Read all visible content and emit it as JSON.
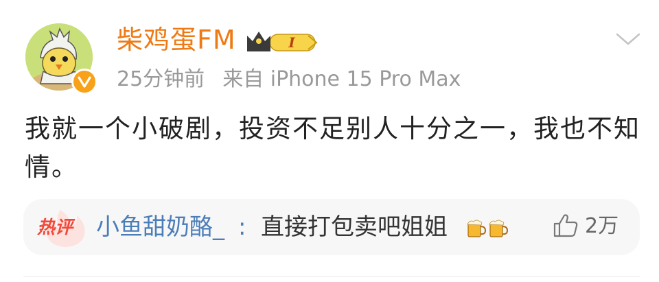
{
  "post": {
    "author": {
      "name": "柴鸡蛋FM",
      "avatar_icon": "chick-avatar-icon",
      "verified_icon": "verified-v-icon",
      "level_badge": {
        "icon": "crown-icon",
        "text": "I"
      }
    },
    "time": "25分钟前",
    "source_prefix": "来自",
    "source": "iPhone 15 Pro Max",
    "more_icon": "chevron-down-icon",
    "text": "我就一个小破剧，投资不足别人十分之一，我也不知情。"
  },
  "hot_comment": {
    "tag": "热评",
    "commenter": "小鱼甜奶酪_",
    "colon": ":",
    "text": "直接打包卖吧姐姐",
    "emojis": [
      "beer-emoji",
      "beer-emoji"
    ],
    "like_icon": "thumbs-up-icon",
    "like_count": "2万"
  },
  "colors": {
    "username": "#ef7a14",
    "meta": "#999999",
    "commenter": "#4b7db8",
    "hot_tag": "#f2493a",
    "comment_bg": "#f7f7f7"
  }
}
